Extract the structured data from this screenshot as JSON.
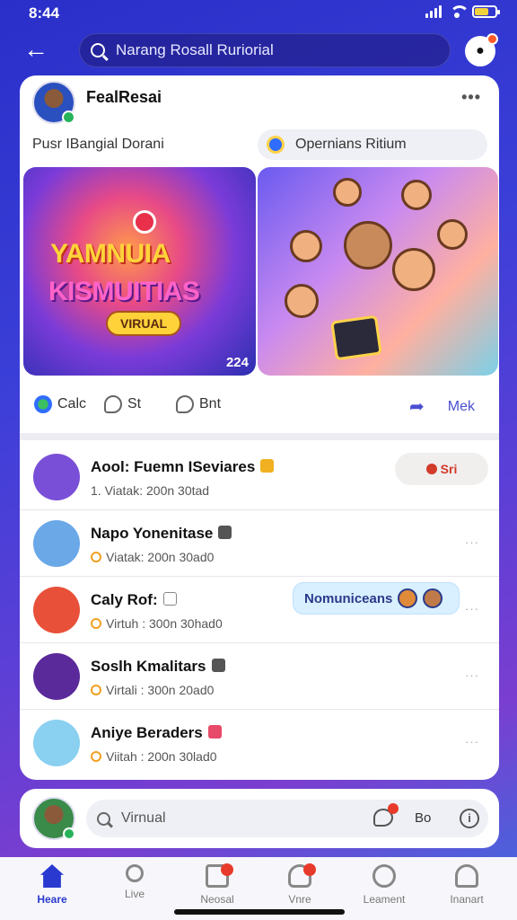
{
  "status": {
    "time": "8:44",
    "battery_level": 0.7
  },
  "header": {
    "search_text": "Narang Rosall Ruriorial"
  },
  "post": {
    "author": "FealResai",
    "more": "•••",
    "subtitle": "Pusr IBangial Dorani",
    "pill_text": "Opernians Ritium",
    "media_left": {
      "title_line1": "YAMNUIA",
      "title_line2": "KISMUITIAS",
      "tag": "VIRUAL",
      "year": "224"
    },
    "actions": {
      "like": "Calc",
      "comment": "St",
      "share_small": "Bnt",
      "share": "Mek"
    }
  },
  "list": [
    {
      "name": "Aool: Fuemn ISeviares",
      "meta": "1. Viatak: 200n 30tad",
      "button": "Sri",
      "avatar_color": "#7a4fd8",
      "icon_color": "#f0b020"
    },
    {
      "name": "Napo Yonenitase",
      "meta": "Viatak: 200n 30ad0",
      "avatar_color": "#6aa8e8",
      "icon_color": "#555555"
    },
    {
      "name": "Caly Rof:",
      "meta": "Virtuh : 300n 30had0",
      "chip": "Nomuniceans",
      "avatar_color": "#e8503a",
      "icon_color": "#888888"
    },
    {
      "name": "Soslh Kmalitars",
      "meta": "Virtali : 300n 20ad0",
      "avatar_color": "#5a2a9a",
      "icon_color": "#555555"
    },
    {
      "name": "Aniye Beraders",
      "meta": "Viitah : 200n 30lad0",
      "avatar_color": "#8ad0f0",
      "icon_color": "#e84a6a"
    }
  ],
  "list_more": "···",
  "composer": {
    "placeholder": "Virnual",
    "label": "Bo",
    "info": "i"
  },
  "nav": [
    {
      "label": "Heare",
      "active": true
    },
    {
      "label": "Live"
    },
    {
      "label": "Neosal"
    },
    {
      "label": "Vnre"
    },
    {
      "label": "Leament"
    },
    {
      "label": "Inanart"
    }
  ]
}
